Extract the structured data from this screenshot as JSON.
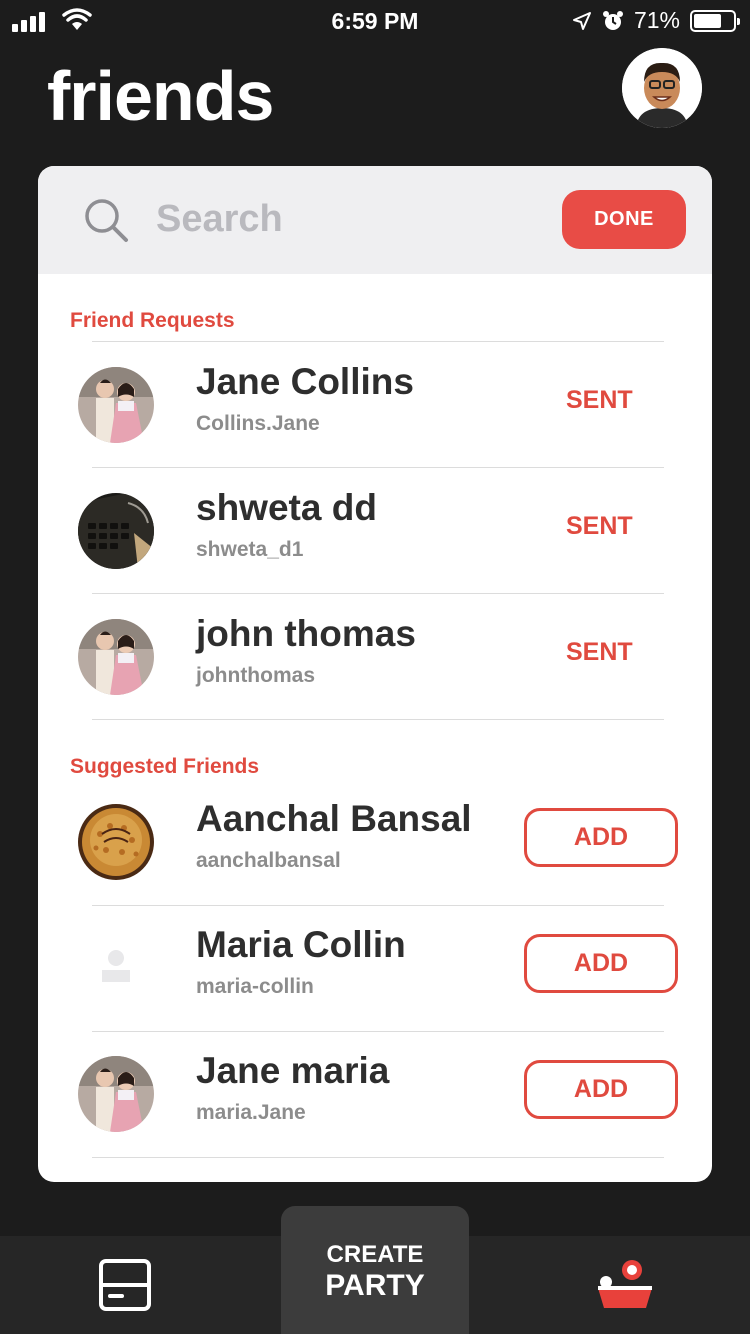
{
  "status_bar": {
    "time": "6:59 PM",
    "battery": "71%",
    "battery_level": 0.71,
    "icons": [
      "signal-icon",
      "wifi-icon",
      "location-icon",
      "alarm-icon",
      "battery-icon"
    ]
  },
  "header": {
    "title": "friends",
    "profile_icon": "profile-avatar"
  },
  "search": {
    "placeholder": "Search",
    "done_label": "DONE"
  },
  "friend_requests": {
    "title": "Friend Requests",
    "items": [
      {
        "name": "Jane Collins",
        "handle": "Collins.Jane",
        "status": "SENT",
        "avatar": "couple-photo"
      },
      {
        "name": "shweta dd",
        "handle": "shweta_d1",
        "status": "SENT",
        "avatar": "keyboard-photo"
      },
      {
        "name": "john thomas",
        "handle": "johnthomas",
        "status": "SENT",
        "avatar": "couple-photo"
      }
    ]
  },
  "suggested_friends": {
    "title": "Suggested Friends",
    "items": [
      {
        "name": "Aanchal Bansal",
        "handle": "aanchalbansal",
        "action": "ADD",
        "avatar": "cake-photo"
      },
      {
        "name": "Maria Collin",
        "handle": "maria-collin",
        "action": "ADD",
        "avatar": "default-user"
      },
      {
        "name": "Jane maria",
        "handle": "maria.Jane",
        "action": "ADD",
        "avatar": "couple-photo"
      }
    ]
  },
  "tab_bar": {
    "create_line1": "CREATE",
    "create_line2": "PARTY",
    "left_icon": "card-icon",
    "right_icon": "party-icon"
  },
  "colors": {
    "accent": "#e04a3f",
    "background": "#1c1c1c",
    "card": "#ffffff"
  }
}
